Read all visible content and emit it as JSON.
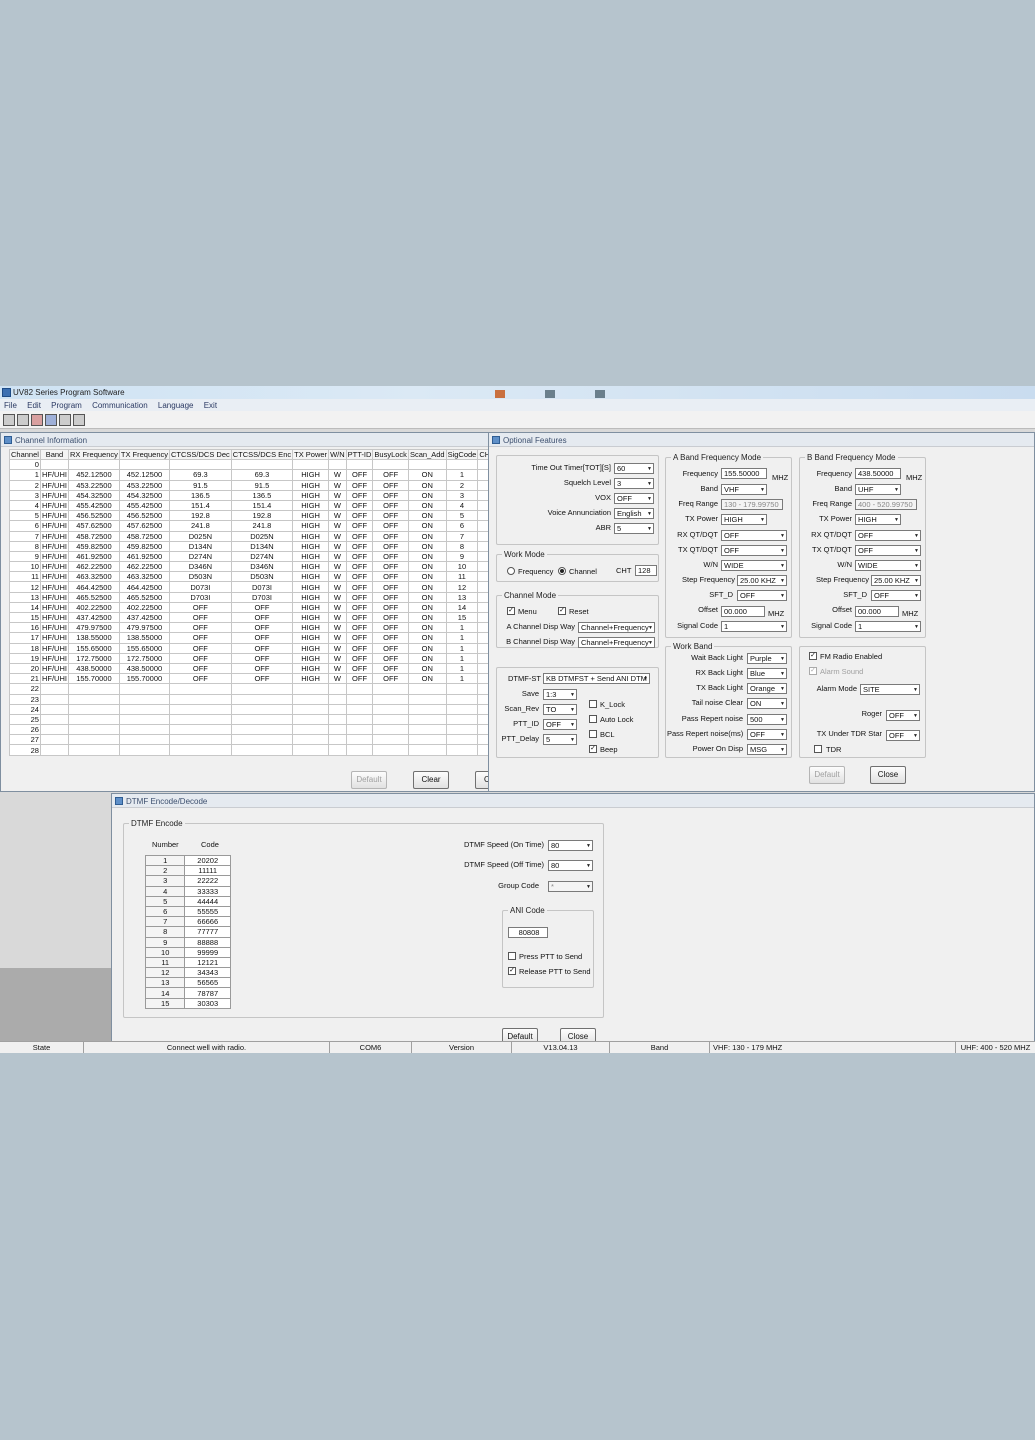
{
  "app": {
    "title": "UV82 Series Program Software"
  },
  "menu": [
    "File",
    "Edit",
    "Program",
    "Communication",
    "Language",
    "Exit"
  ],
  "toolbar_icons": [
    "open-icon",
    "save-icon",
    "read-icon",
    "write-icon",
    "radio-icon",
    "help-icon"
  ],
  "channel_window": {
    "title": "Channel Information",
    "columns": [
      "Channel",
      "Band",
      "RX Frequency",
      "TX Frequency",
      "CTCSS/DCS Dec",
      "CTCSS/DCS Enc",
      "TX Power",
      "W/N",
      "PTT-ID",
      "BusyLock",
      "Scan_Add",
      "SigCode",
      "CH-Name"
    ],
    "rows": [
      [
        "0",
        "",
        "",
        "",
        "",
        "",
        "",
        "",
        "",
        "",
        "",
        "",
        ""
      ],
      [
        "1",
        "HF/UHI",
        "452.12500",
        "452.12500",
        "69.3",
        "69.3",
        "HIGH",
        "W",
        "OFF",
        "OFF",
        "ON",
        "1",
        ""
      ],
      [
        "2",
        "HF/UHI",
        "453.22500",
        "453.22500",
        "91.5",
        "91.5",
        "HIGH",
        "W",
        "OFF",
        "OFF",
        "ON",
        "2",
        ""
      ],
      [
        "3",
        "HF/UHI",
        "454.32500",
        "454.32500",
        "136.5",
        "136.5",
        "HIGH",
        "W",
        "OFF",
        "OFF",
        "ON",
        "3",
        ""
      ],
      [
        "4",
        "HF/UHI",
        "455.42500",
        "455.42500",
        "151.4",
        "151.4",
        "HIGH",
        "W",
        "OFF",
        "OFF",
        "ON",
        "4",
        ""
      ],
      [
        "5",
        "HF/UHI",
        "456.52500",
        "456.52500",
        "192.8",
        "192.8",
        "HIGH",
        "W",
        "OFF",
        "OFF",
        "ON",
        "5",
        ""
      ],
      [
        "6",
        "HF/UHI",
        "457.62500",
        "457.62500",
        "241.8",
        "241.8",
        "HIGH",
        "W",
        "OFF",
        "OFF",
        "ON",
        "6",
        ""
      ],
      [
        "7",
        "HF/UHI",
        "458.72500",
        "458.72500",
        "D025N",
        "D025N",
        "HIGH",
        "W",
        "OFF",
        "OFF",
        "ON",
        "7",
        ""
      ],
      [
        "8",
        "HF/UHI",
        "459.82500",
        "459.82500",
        "D134N",
        "D134N",
        "HIGH",
        "W",
        "OFF",
        "OFF",
        "ON",
        "8",
        ""
      ],
      [
        "9",
        "HF/UHI",
        "461.92500",
        "461.92500",
        "D274N",
        "D274N",
        "HIGH",
        "W",
        "OFF",
        "OFF",
        "ON",
        "9",
        ""
      ],
      [
        "10",
        "HF/UHI",
        "462.22500",
        "462.22500",
        "D346N",
        "D346N",
        "HIGH",
        "W",
        "OFF",
        "OFF",
        "ON",
        "10",
        ""
      ],
      [
        "11",
        "HF/UHI",
        "463.32500",
        "463.32500",
        "D503N",
        "D503N",
        "HIGH",
        "W",
        "OFF",
        "OFF",
        "ON",
        "11",
        ""
      ],
      [
        "12",
        "HF/UHI",
        "464.42500",
        "464.42500",
        "D073I",
        "D073I",
        "HIGH",
        "W",
        "OFF",
        "OFF",
        "ON",
        "12",
        ""
      ],
      [
        "13",
        "HF/UHI",
        "465.52500",
        "465.52500",
        "D703I",
        "D703I",
        "HIGH",
        "W",
        "OFF",
        "OFF",
        "ON",
        "13",
        ""
      ],
      [
        "14",
        "HF/UHI",
        "402.22500",
        "402.22500",
        "OFF",
        "OFF",
        "HIGH",
        "W",
        "OFF",
        "OFF",
        "ON",
        "14",
        ""
      ],
      [
        "15",
        "HF/UHI",
        "437.42500",
        "437.42500",
        "OFF",
        "OFF",
        "HIGH",
        "W",
        "OFF",
        "OFF",
        "ON",
        "15",
        ""
      ],
      [
        "16",
        "HF/UHI",
        "479.97500",
        "479.97500",
        "OFF",
        "OFF",
        "HIGH",
        "W",
        "OFF",
        "OFF",
        "ON",
        "1",
        ""
      ],
      [
        "17",
        "HF/UHI",
        "138.55000",
        "138.55000",
        "OFF",
        "OFF",
        "HIGH",
        "W",
        "OFF",
        "OFF",
        "ON",
        "1",
        ""
      ],
      [
        "18",
        "HF/UHI",
        "155.65000",
        "155.65000",
        "OFF",
        "OFF",
        "HIGH",
        "W",
        "OFF",
        "OFF",
        "ON",
        "1",
        ""
      ],
      [
        "19",
        "HF/UHI",
        "172.75000",
        "172.75000",
        "OFF",
        "OFF",
        "HIGH",
        "W",
        "OFF",
        "OFF",
        "ON",
        "1",
        ""
      ],
      [
        "20",
        "HF/UHI",
        "438.50000",
        "438.50000",
        "OFF",
        "OFF",
        "HIGH",
        "W",
        "OFF",
        "OFF",
        "ON",
        "1",
        ""
      ],
      [
        "21",
        "HF/UHI",
        "155.70000",
        "155.70000",
        "OFF",
        "OFF",
        "HIGH",
        "W",
        "OFF",
        "OFF",
        "ON",
        "1",
        ""
      ],
      [
        "22",
        "",
        "",
        "",
        "",
        "",
        "",
        "",
        "",
        "",
        "",
        "",
        ""
      ],
      [
        "23",
        "",
        "",
        "",
        "",
        "",
        "",
        "",
        "",
        "",
        "",
        "",
        ""
      ],
      [
        "24",
        "",
        "",
        "",
        "",
        "",
        "",
        "",
        "",
        "",
        "",
        "",
        ""
      ],
      [
        "25",
        "",
        "",
        "",
        "",
        "",
        "",
        "",
        "",
        "",
        "",
        "",
        ""
      ],
      [
        "26",
        "",
        "",
        "",
        "",
        "",
        "",
        "",
        "",
        "",
        "",
        "",
        ""
      ],
      [
        "27",
        "",
        "",
        "",
        "",
        "",
        "",
        "",
        "",
        "",
        "",
        "",
        ""
      ],
      [
        "28",
        "",
        "",
        "",
        "",
        "",
        "",
        "",
        "",
        "",
        "",
        "",
        ""
      ]
    ],
    "buttons": {
      "default": "Default",
      "clear": "Clear",
      "close_partial": "Cl"
    }
  },
  "optional_window": {
    "title": "Optional Features",
    "basic": {
      "tot_label": "Time Out Timer[TOT][S]",
      "tot_value": "60",
      "squelch_label": "Squelch Level",
      "squelch_value": "3",
      "vox_label": "VOX",
      "vox_value": "OFF",
      "voice_label": "Voice Annunciation",
      "voice_value": "English",
      "abr_label": "ABR",
      "abr_value": "5"
    },
    "work_mode": {
      "title": "Work Mode",
      "frequency": "Frequency",
      "channel": "Channel",
      "cht_label": "CHT",
      "cht_value": "128"
    },
    "channel_mode": {
      "title": "Channel Mode",
      "menu": "Menu",
      "reset": "Reset",
      "a_label": "A Channel Disp Way",
      "a_value": "Channel+Frequency",
      "b_label": "B Channel Disp Way",
      "b_value": "Channel+Frequency"
    },
    "dtmf": {
      "dtmf_st_label": "DTMF-ST",
      "dtmf_st_value": "KB DTMFST + Send ANI DTM",
      "save_label": "Save",
      "save_value": "1:3",
      "scanrev_label": "Scan_Rev",
      "scanrev_value": "TO",
      "pttid_label": "PTT_ID",
      "pttid_value": "OFF",
      "pttdelay_label": "PTT_Delay",
      "pttdelay_value": "5",
      "klock": "K_Lock",
      "autolock": "Auto Lock",
      "bcl": "BCL",
      "beep": "Beep"
    },
    "a_band": {
      "title": "A Band Frequency Mode",
      "freq_label": "Frequency",
      "freq_value": "155.50000",
      "unit": "MHZ",
      "band_label": "Band",
      "band_value": "VHF",
      "range_label": "Freq Range",
      "range_value": "130 - 179.99750",
      "txp_label": "TX Power",
      "txp_value": "HIGH",
      "rxqt_label": "RX QT/DQT",
      "rxqt_value": "OFF",
      "txqt_label": "TX QT/DQT",
      "txqt_value": "OFF",
      "wn_label": "W/N",
      "wn_value": "WIDE",
      "step_label": "Step Frequency",
      "step_value": "25.00 KHZ",
      "sftd_label": "SFT_D",
      "sftd_value": "OFF",
      "offset_label": "Offset",
      "offset_value": "00.000",
      "offset_unit": "MHZ",
      "sig_label": "Signal Code",
      "sig_value": "1"
    },
    "b_band": {
      "title": "B Band Frequency Mode",
      "freq_label": "Frequency",
      "freq_value": "438.50000",
      "unit": "MHZ",
      "band_label": "Band",
      "band_value": "UHF",
      "range_label": "Freq Range",
      "range_value": "400 - 520.99750",
      "txp_label": "TX Power",
      "txp_value": "HIGH",
      "rxqt_label": "RX QT/DQT",
      "rxqt_value": "OFF",
      "txqt_label": "TX QT/DQT",
      "txqt_value": "OFF",
      "wn_label": "W/N",
      "wn_value": "WIDE",
      "step_label": "Step Frequency",
      "step_value": "25.00 KHZ",
      "sftd_label": "SFT_D",
      "sftd_value": "OFF",
      "offset_label": "Offset",
      "offset_value": "00.000",
      "offset_unit": "MHZ",
      "sig_label": "Signal Code",
      "sig_value": "1"
    },
    "work_band": {
      "title": "Work Band",
      "wait_label": "Wait Back Light",
      "wait_value": "Purple",
      "rx_label": "RX Back Light",
      "rx_value": "Blue",
      "tx_label": "TX Back Light",
      "tx_value": "Orange",
      "tail_label": "Tail noise Clear",
      "tail_value": "ON",
      "repeat_label": "Pass Repert noise",
      "repeat_value": "500",
      "repeat2_label": "Pass Repert noise(ms)",
      "repeat2_value": "OFF",
      "power_label": "Power On Disp",
      "power_value": "MSG"
    },
    "misc": {
      "fm": "FM Radio Enabled",
      "alarm_sound": "Alarm Sound",
      "alarm_mode_label": "Alarm Mode",
      "alarm_mode_value": "SITE",
      "roger_label": "Roger",
      "roger_value": "OFF",
      "tdr_star_label": "TX Under TDR Star",
      "tdr_star_value": "OFF",
      "tdr": "TDR"
    },
    "buttons": {
      "default": "Default",
      "close": "Close"
    }
  },
  "dtmf_window": {
    "title": "DTMF Encode/Decode",
    "group_title": "DTMF Encode",
    "col_number": "Number",
    "col_code": "Code",
    "codes": [
      [
        "1",
        "20202"
      ],
      [
        "2",
        "11111"
      ],
      [
        "3",
        "22222"
      ],
      [
        "4",
        "33333"
      ],
      [
        "5",
        "44444"
      ],
      [
        "6",
        "55555"
      ],
      [
        "7",
        "66666"
      ],
      [
        "8",
        "77777"
      ],
      [
        "9",
        "88888"
      ],
      [
        "10",
        "99999"
      ],
      [
        "11",
        "12121"
      ],
      [
        "12",
        "34343"
      ],
      [
        "13",
        "56565"
      ],
      [
        "14",
        "78787"
      ],
      [
        "15",
        "30303"
      ]
    ],
    "speed_on_label": "DTMF Speed (On Time)",
    "speed_on_value": "80",
    "speed_off_label": "DTMF Speed (Off Time)",
    "speed_off_value": "80",
    "group_code_label": "Group Code",
    "group_code_value": "*",
    "ani_title": "ANI Code",
    "ani_value": "80808",
    "press_ptt": "Press PTT to Send",
    "release_ptt": "Release PTT to Send",
    "buttons": {
      "default": "Default",
      "close": "Close"
    }
  },
  "status": {
    "state": "State",
    "message": "Connect well with radio.",
    "port": "COM6",
    "version_label": "Version",
    "version": "V13.04.13",
    "band_label": "Band",
    "vhf": "VHF: 130 - 179 MHZ",
    "uhf": "UHF: 400 - 520 MHZ"
  }
}
